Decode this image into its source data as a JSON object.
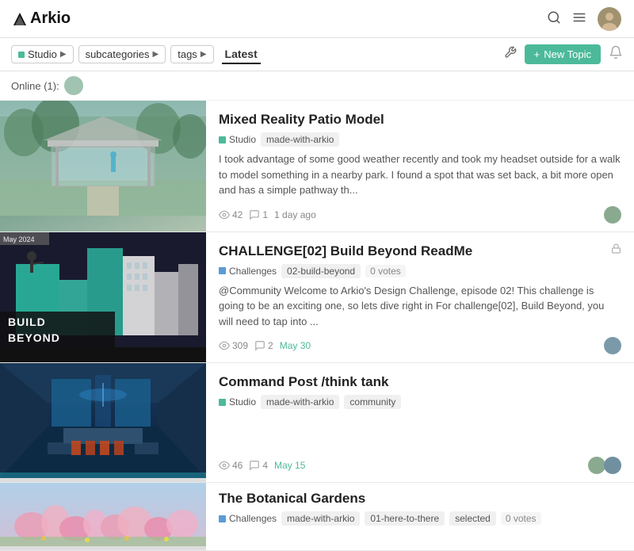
{
  "header": {
    "logo_text": "Arkio",
    "search_label": "search",
    "menu_label": "menu",
    "avatar_label": "user-avatar"
  },
  "filter_bar": {
    "studio_label": "Studio",
    "subcategories_label": "subcategories",
    "tags_label": "tags",
    "latest_label": "Latest",
    "new_topic_label": "+ New Topic",
    "wrench_icon": "⚙",
    "bell_icon": "🔔"
  },
  "online_bar": {
    "text": "Online (1):"
  },
  "posts": [
    {
      "id": "patio",
      "title": "Mixed Reality Patio Model",
      "category": "Studio",
      "category_color": "studio",
      "tags": [
        "made-with-arkio"
      ],
      "excerpt": "I took advantage of some good weather recently and took my headset outside for a walk to model something in a nearby park. I found a spot that was set back, a bit more open and has a simple pathway th...",
      "views": "42",
      "replies": "1",
      "time": "1 day ago",
      "locked": false,
      "votes": null,
      "thumb_type": "patio"
    },
    {
      "id": "build-beyond",
      "title": "CHALLENGE[02] Build Beyond ReadMe",
      "category": "Challenges",
      "category_color": "challenges",
      "tags": [
        "02-build-beyond",
        "0 votes"
      ],
      "excerpt": "@Community Welcome to Arkio's Design Challenge, episode 02! This challenge is going to be an exciting one, so lets dive right in For challenge[02], Build Beyond, you will need to tap into ...",
      "views": "309",
      "replies": "2",
      "time": "May 30",
      "locked": true,
      "votes": "0 votes",
      "thumb_type": "build"
    },
    {
      "id": "command-post",
      "title": "Command Post /think tank",
      "category": "Studio",
      "category_color": "studio",
      "tags": [
        "made-with-arkio",
        "community"
      ],
      "excerpt": "",
      "views": "46",
      "replies": "4",
      "time": "May 15",
      "locked": false,
      "votes": null,
      "thumb_type": "command"
    },
    {
      "id": "botanical",
      "title": "The Botanical Gardens",
      "category": "Challenges",
      "category_color": "challenges",
      "tags": [
        "made-with-arkio",
        "01-here-to-there",
        "selected",
        "0 votes"
      ],
      "excerpt": "",
      "views": "",
      "replies": "",
      "time": "",
      "locked": false,
      "votes": "0 votes",
      "thumb_type": "botanical"
    }
  ]
}
